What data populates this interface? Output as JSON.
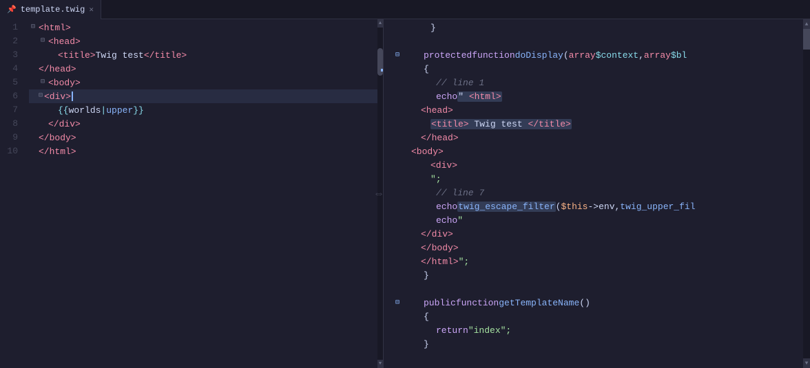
{
  "tab": {
    "filename": "template.twig",
    "pin_icon": "📌",
    "close_icon": "✕"
  },
  "left_panel": {
    "lines": [
      {
        "num": 1,
        "content": "<html>",
        "indent": 0,
        "foldable": true,
        "folded": false
      },
      {
        "num": 2,
        "content": "<head>",
        "indent": 1,
        "foldable": true,
        "folded": false
      },
      {
        "num": 3,
        "content": "<title>Twig test</title>",
        "indent": 2,
        "foldable": false
      },
      {
        "num": 4,
        "content": "</head>",
        "indent": 1,
        "foldable": false
      },
      {
        "num": 5,
        "content": "<body>",
        "indent": 1,
        "foldable": true,
        "folded": false
      },
      {
        "num": 6,
        "content": "<div>",
        "indent": 2,
        "foldable": true,
        "folded": false,
        "active": true
      },
      {
        "num": 7,
        "content": "{{ worlds|upper }}",
        "indent": 3,
        "foldable": false
      },
      {
        "num": 8,
        "content": "</div>",
        "indent": 2,
        "foldable": false
      },
      {
        "num": 9,
        "content": "</body>",
        "indent": 1,
        "foldable": false
      },
      {
        "num": 10,
        "content": "</html>",
        "indent": 1,
        "foldable": false
      }
    ]
  },
  "right_panel": {
    "lines": [
      {
        "content": "    }",
        "type": "php"
      },
      {
        "content": "",
        "type": "blank"
      },
      {
        "content": "    protected function doDisplay(array $context, array $bl",
        "type": "php",
        "fold": true
      },
      {
        "content": "    {",
        "type": "php"
      },
      {
        "content": "        // line 1",
        "type": "comment"
      },
      {
        "content": "        echo \"<html>",
        "type": "php",
        "highlight": true
      },
      {
        "content": "    <head>",
        "type": "html"
      },
      {
        "content": "        <title>Twig test</title>",
        "type": "html",
        "highlight": true
      },
      {
        "content": "    </head>",
        "type": "html"
      },
      {
        "content": "    <body>",
        "type": "html"
      },
      {
        "content": "        <div>",
        "type": "html"
      },
      {
        "content": "        \";",
        "type": "php"
      },
      {
        "content": "        // line 7",
        "type": "comment"
      },
      {
        "content": "        echo twig_escape_filter($this->env, twig_upper_fil",
        "type": "php",
        "highlight": true
      },
      {
        "content": "        echo \"",
        "type": "php"
      },
      {
        "content": "    </div>",
        "type": "html"
      },
      {
        "content": "    </body>",
        "type": "html"
      },
      {
        "content": "    </html>\";",
        "type": "php"
      },
      {
        "content": "    }",
        "type": "php"
      },
      {
        "content": "",
        "type": "blank"
      },
      {
        "content": "    public function getTemplateName()",
        "type": "php",
        "fold": true
      },
      {
        "content": "    {",
        "type": "php"
      },
      {
        "content": "        return \"index\";",
        "type": "php"
      },
      {
        "content": "    }",
        "type": "php"
      }
    ]
  },
  "colors": {
    "bg": "#1e1e2e",
    "tab_bg": "#1e1e2e",
    "tab_bar_bg": "#181825",
    "line_number": "#45475a",
    "active_line": "rgba(137,180,250,0.08)",
    "tag": "#f38ba8",
    "string": "#a6e3a1",
    "keyword": "#cba6f7",
    "twig": "#89dceb",
    "php_var": "#89dceb",
    "comment": "#6c7086",
    "scrollbar_thumb": "#45475a",
    "accent": "#89b4fa"
  }
}
